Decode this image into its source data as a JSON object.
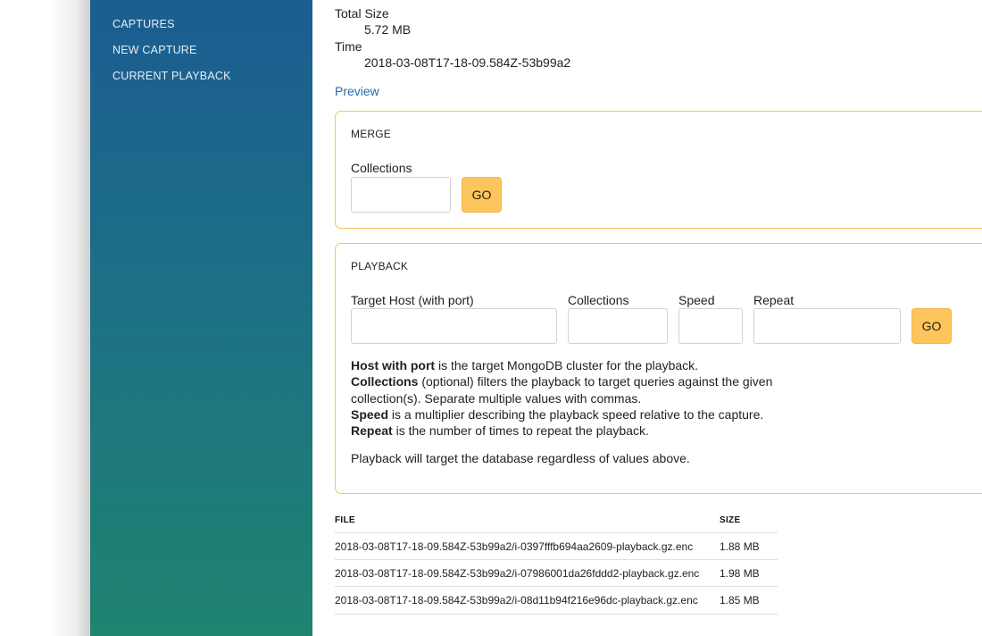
{
  "sidebar": {
    "items": [
      {
        "label": "CAPTURES"
      },
      {
        "label": "NEW CAPTURE"
      },
      {
        "label": "CURRENT PLAYBACK"
      }
    ]
  },
  "details": {
    "total_size_label": "Total Size",
    "total_size_value": "5.72 MB",
    "time_label": "Time",
    "time_value": "2018-03-08T17-18-09.584Z-53b99a2",
    "preview_link": "Preview"
  },
  "merge": {
    "title": "MERGE",
    "collections_label": "Collections",
    "collections_value": "",
    "go_label": "GO"
  },
  "playback": {
    "title": "PLAYBACK",
    "target_host_label": "Target Host (with port)",
    "target_host_value": "",
    "collections_label": "Collections",
    "collections_value": "",
    "speed_label": "Speed",
    "speed_value": "",
    "repeat_label": "Repeat",
    "repeat_value": "",
    "go_label": "GO",
    "help": [
      {
        "term": "Host with port",
        "text": " is the target MongoDB cluster for the playback."
      },
      {
        "term": "Collections",
        "text": " (optional) filters the playback to target queries against the given collection(s). Separate multiple values with commas."
      },
      {
        "term": "Speed",
        "text": " is a multiplier describing the playback speed relative to the capture."
      },
      {
        "term": "Repeat",
        "text": " is the number of times to repeat the playback."
      }
    ],
    "note": "Playback will target the database regardless of values above."
  },
  "files_table": {
    "headers": {
      "file": "FILE",
      "size": "SIZE"
    },
    "rows": [
      {
        "file": "2018-03-08T17-18-09.584Z-53b99a2/i-0397fffb694aa2609-playback.gz.enc",
        "size": "1.88 MB"
      },
      {
        "file": "2018-03-08T17-18-09.584Z-53b99a2/i-07986001da26fddd2-playback.gz.enc",
        "size": "1.98 MB"
      },
      {
        "file": "2018-03-08T17-18-09.584Z-53b99a2/i-08d11b94f216e96dc-playback.gz.enc",
        "size": "1.85 MB"
      }
    ]
  }
}
